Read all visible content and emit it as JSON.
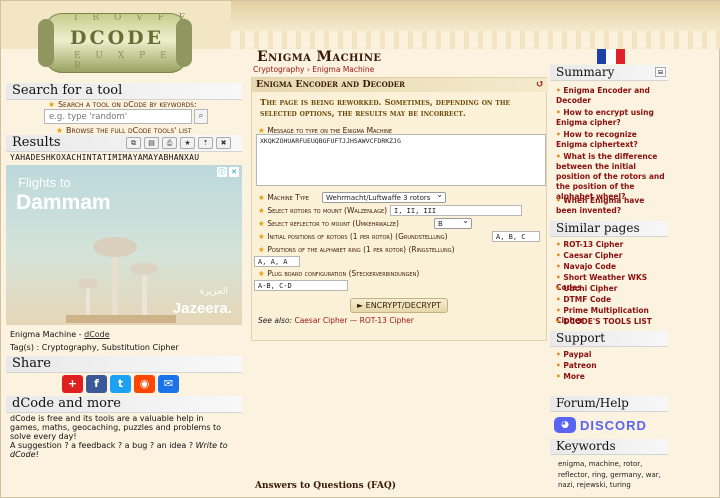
{
  "logo": {
    "text": "DCODE",
    "row_top": "I R O V F E",
    "row_bottom": "E U X P E R"
  },
  "search_tool": {
    "heading": "Search for a tool",
    "link_label": "Search a tool on dCode by keywords:",
    "placeholder": "e.g. type 'random'",
    "search_icon": "search-icon",
    "browse_label": "Browse the full dCode tools' list"
  },
  "results": {
    "heading": "Results",
    "tool_icons": [
      "copy-icon",
      "save-icon",
      "print-icon",
      "star-icon",
      "pin-icon",
      "close-icon"
    ],
    "tool_glyphs": [
      "⧉",
      "▤",
      "⎙",
      "★",
      "⇡",
      "✖"
    ],
    "output": "YAHADESHKOXACHINTATIMIMAYAMAYABHANXAU"
  },
  "ad": {
    "line1": "Flights to",
    "line2": "Dammam",
    "brand": "Jazeera.",
    "brand_ar": "الجزيرة",
    "info_glyph": "ⓘ",
    "close_glyph": "✕"
  },
  "tool_info": {
    "name_line_prefix": "Enigma Machine - ",
    "name_line_link": "dCode",
    "tags_prefix": "Tag(s) : ",
    "tags": "Cryptography, Substitution Cipher"
  },
  "share": {
    "heading": "Share",
    "buttons": [
      {
        "icon": "plus-icon",
        "glyph": "+",
        "color": "#e02020"
      },
      {
        "icon": "facebook-icon",
        "glyph": "f",
        "color": "#3b5998"
      },
      {
        "icon": "twitter-icon",
        "glyph": "t",
        "color": "#1da1f2"
      },
      {
        "icon": "reddit-icon",
        "glyph": "◉",
        "color": "#ff4500"
      },
      {
        "icon": "email-icon",
        "glyph": "✉",
        "color": "#1a73e8"
      }
    ]
  },
  "more": {
    "heading": "dCode and more",
    "line1": "dCode is free and its tools are a valuable help in",
    "line2": "games, maths, geocaching, puzzles and problems to",
    "line3": "solve every day!",
    "line4_prefix": "A suggestion ? a feedback ? a bug ? an idea ? ",
    "line4_em": "Write to",
    "line5_em": "dCode",
    "line5_suffix": "!"
  },
  "main": {
    "title": "Enigma Machine",
    "breadcrumb": "Cryptography  ›  Enigma Machine",
    "flag_colors": [
      "#1f3fa8",
      "#ffffff",
      "#e0202a"
    ],
    "panel_title": "Enigma Encoder and Decoder",
    "refresh_glyph": "↺",
    "warning": "The page is being reworked. Sometimes, depending on the selected options, the results may be incorrect.",
    "message_label": "Message to type on the Enigma Machine",
    "message_value": "XKQKZOHUARFUEUQBGFUFTJJHSAWVCFDRKZJG",
    "machine_type_label": "Machine Type",
    "machine_type_value": "Wehrmacht/Luftwaffe 3 rotors",
    "rotors_label": "Select rotors to mount (Walzenlage)",
    "rotors_value": "I, II, III",
    "reflector_label": "Select reflector to mount (Umkehrwalze)",
    "reflector_value": "B",
    "initial_label": "Initial positions of rotors (1 per rotor) (Grundstellung)",
    "initial_value": "A, B, C",
    "ring_label": "Positions of the alphabet ring (1 per rotor) (Ringstellung)",
    "ring_value": "A, A, A",
    "plug_label": "Plug board configuration (Steckerverbindungen)",
    "plug_value": "A-B, C-D",
    "button_label": "► ENCRYPT/DECRYPT",
    "see_also_prefix": "See also:",
    "see_also_links": "Caesar Cipher — ROT-13 Cipher",
    "faq": "Answers to Questions (FAQ)"
  },
  "summary": {
    "heading": "Summary",
    "collapse_glyph": "⊟",
    "items": [
      "Enigma Encoder and Decoder",
      "How to encrypt using Enigma cipher?",
      "How to recognize Enigma ciphertext?",
      "What is the difference between the initial position of the rotors and the position of the alphabet wheel?",
      "When Enigma have been invented?"
    ]
  },
  "similar": {
    "heading": "Similar pages",
    "items": [
      "ROT-13 Cipher",
      "Caesar Cipher",
      "Navajo Code",
      "Short Weather WKS Codes",
      "Ubchi Cipher",
      "DTMF Code",
      "Prime Multiplication Cipher",
      "DCODE'S TOOLS LIST"
    ]
  },
  "support": {
    "heading": "Support",
    "items": [
      "Paypal",
      "Patreon",
      "More"
    ]
  },
  "forum": {
    "heading": "Forum/Help",
    "discord_label": "DISCORD"
  },
  "keywords": {
    "heading": "Keywords",
    "text": "enigma, machine, rotor, reflector, ring, germany, war, nazi, rejewski, turing"
  }
}
